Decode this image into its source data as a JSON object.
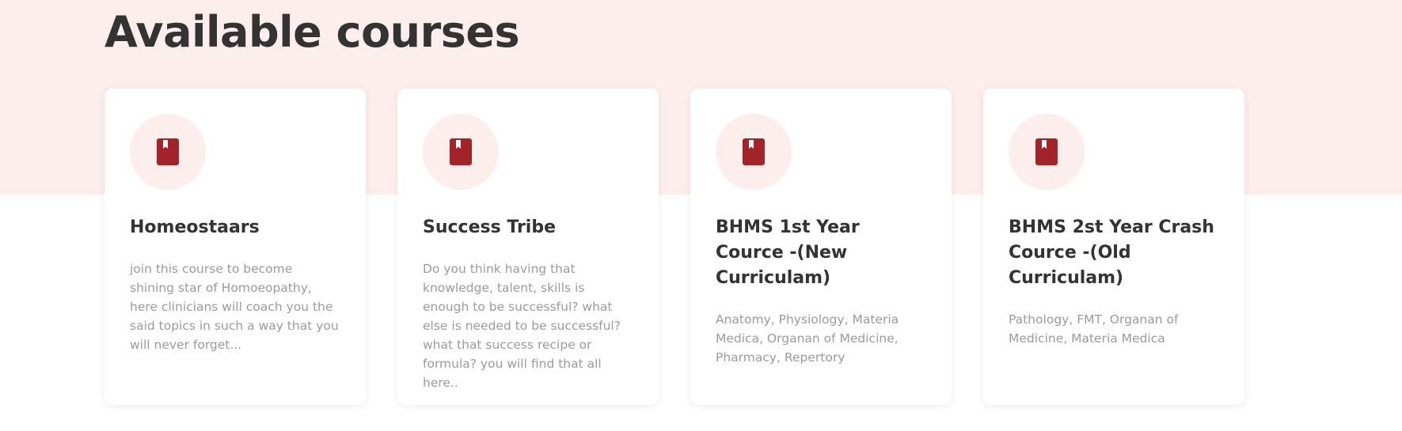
{
  "page": {
    "title": "Available courses"
  },
  "colors": {
    "band": "#fdeeee",
    "accent": "#a3232a",
    "title_text": "#333333",
    "desc_text": "#9b9b9b"
  },
  "courses": [
    {
      "icon": "book-icon",
      "title": "Homeostaars",
      "description": "join this course to become shining star of Homoeopathy,  here clinicians will coach you the said topics in such a way that you will never forget..."
    },
    {
      "icon": "book-icon",
      "title": "Success Tribe",
      "description": "Do you think having that knowledge, talent, skills is enough to be successful?  what else is needed to be successful? what that success recipe or formula?  you will find that all here.."
    },
    {
      "icon": "book-icon",
      "title": "BHMS 1st Year Cource -(New Curriculam)",
      "description": "Anatomy, Physiology, Materia Medica, Organan of Medicine, Pharmacy, Repertory"
    },
    {
      "icon": "book-icon",
      "title": "BHMS 2st Year Crash Cource -(Old Curriculam)",
      "description": "Pathology, FMT, Organan of Medicine, Materia Medica"
    }
  ]
}
